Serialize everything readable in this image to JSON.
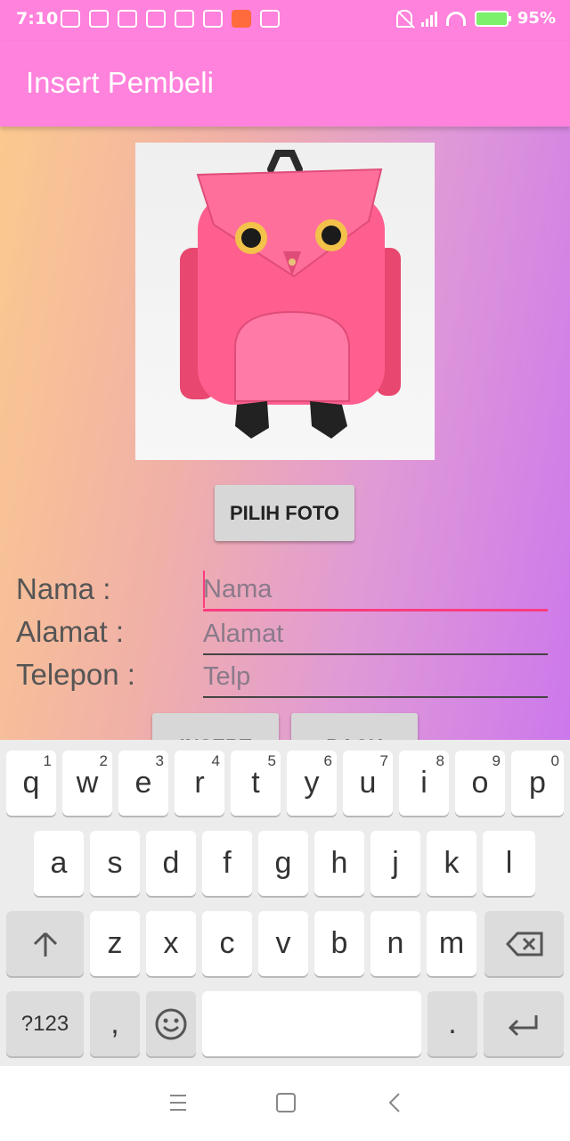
{
  "statusbar": {
    "time": "7:10",
    "battery": "95%"
  },
  "toolbar": {
    "title": "Insert Pembeli"
  },
  "form": {
    "pick_photo_label": "PILIH FOTO",
    "nama_label": "Nama :",
    "alamat_label": "Alamat :",
    "telepon_label": "Telepon :",
    "nama_placeholder": "Nama",
    "alamat_placeholder": "Alamat",
    "telp_placeholder": "Telp",
    "insert_label": "INSERT",
    "back_label": "BACK"
  },
  "colors": {
    "accent": "#ff82dc",
    "focus": "#ff3b7f"
  },
  "keyboard": {
    "row1": [
      {
        "k": "q",
        "n": "1"
      },
      {
        "k": "w",
        "n": "2"
      },
      {
        "k": "e",
        "n": "3"
      },
      {
        "k": "r",
        "n": "4"
      },
      {
        "k": "t",
        "n": "5"
      },
      {
        "k": "y",
        "n": "6"
      },
      {
        "k": "u",
        "n": "7"
      },
      {
        "k": "i",
        "n": "8"
      },
      {
        "k": "o",
        "n": "9"
      },
      {
        "k": "p",
        "n": "0"
      }
    ],
    "row2": [
      "a",
      "s",
      "d",
      "f",
      "g",
      "h",
      "j",
      "k",
      "l"
    ],
    "row3": [
      "z",
      "x",
      "c",
      "v",
      "b",
      "n",
      "m"
    ],
    "sym_label": "?123",
    "comma": ",",
    "period": "."
  }
}
